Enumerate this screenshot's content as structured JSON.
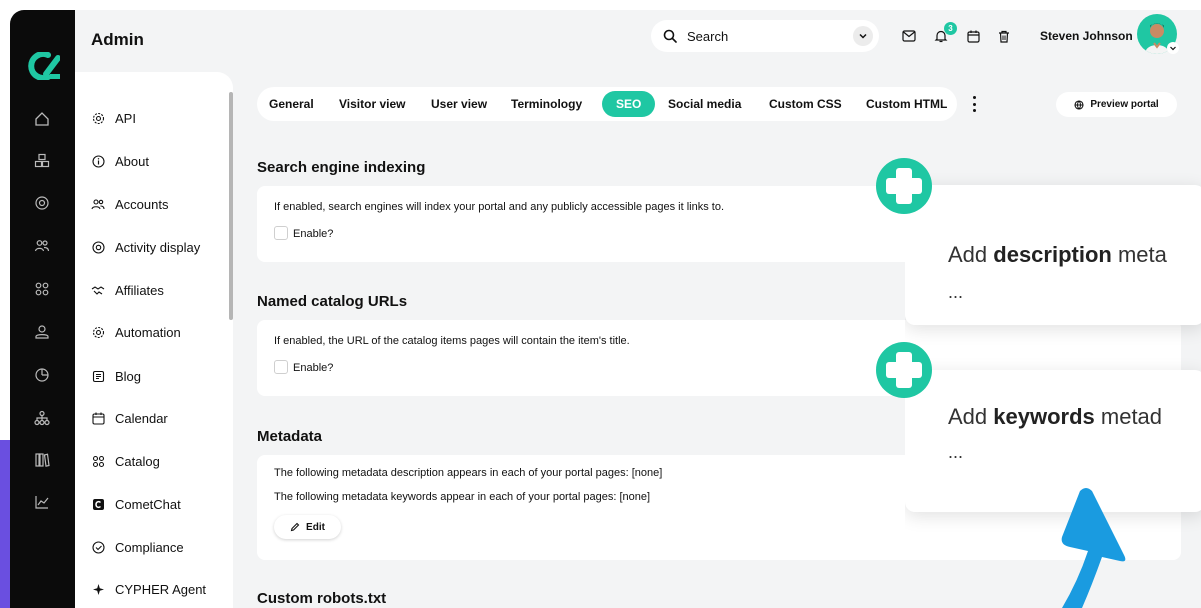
{
  "header": {
    "title": "Admin",
    "search_placeholder": "Search",
    "notification_count": "3",
    "user_name": "Steven Johnson"
  },
  "colors": {
    "accent": "#1fc7a3",
    "rail": "#0b0b0b",
    "edge": "#6a4fe0",
    "arrow": "#1a9be0"
  },
  "rail_icons": [
    "home-icon",
    "cubes-icon",
    "target-icon",
    "users-icon",
    "grid-icon",
    "user-icon",
    "pie-icon",
    "network-icon",
    "library-icon",
    "chart-icon"
  ],
  "sidebar": {
    "items": [
      {
        "label": "API",
        "icon": "gear-icon"
      },
      {
        "label": "About",
        "icon": "info-icon"
      },
      {
        "label": "Accounts",
        "icon": "users-icon"
      },
      {
        "label": "Activity display",
        "icon": "target-icon"
      },
      {
        "label": "Affiliates",
        "icon": "handshake-icon"
      },
      {
        "label": "Automation",
        "icon": "gear-icon"
      },
      {
        "label": "Blog",
        "icon": "blog-icon"
      },
      {
        "label": "Calendar",
        "icon": "calendar-icon"
      },
      {
        "label": "Catalog",
        "icon": "grid-icon"
      },
      {
        "label": "CometChat",
        "icon": "chat-icon"
      },
      {
        "label": "Compliance",
        "icon": "shield-icon"
      },
      {
        "label": "CYPHER Agent",
        "icon": "sparkle-icon"
      }
    ]
  },
  "tabs": [
    {
      "label": "General"
    },
    {
      "label": "Visitor view"
    },
    {
      "label": "User view"
    },
    {
      "label": "Terminology"
    },
    {
      "label": "SEO",
      "active": true
    },
    {
      "label": "Social media"
    },
    {
      "label": "Custom CSS"
    },
    {
      "label": "Custom HTML"
    }
  ],
  "preview_label": "Preview portal",
  "sections": {
    "indexing": {
      "title": "Search engine indexing",
      "description": "If enabled, search engines will index your portal and any publicly accessible pages it links to.",
      "checkbox_label": "Enable?"
    },
    "catalog_urls": {
      "title": "Named catalog URLs",
      "description": "If enabled, the URL of the catalog items pages will contain the item's title.",
      "checkbox_label": "Enable?"
    },
    "metadata": {
      "title": "Metadata",
      "line1": "The following metadata description appears in each of your portal pages: [none]",
      "line2": "The following metadata keywords appear in each of your portal pages: [none]",
      "edit_label": "Edit"
    },
    "robots": {
      "title": "Custom robots.txt"
    }
  },
  "callouts": [
    {
      "prefix": "Add ",
      "bold": "description",
      "suffix": " meta",
      "dots": "..."
    },
    {
      "prefix": "Add ",
      "bold": "keywords",
      "suffix": " metad",
      "dots": "..."
    }
  ]
}
